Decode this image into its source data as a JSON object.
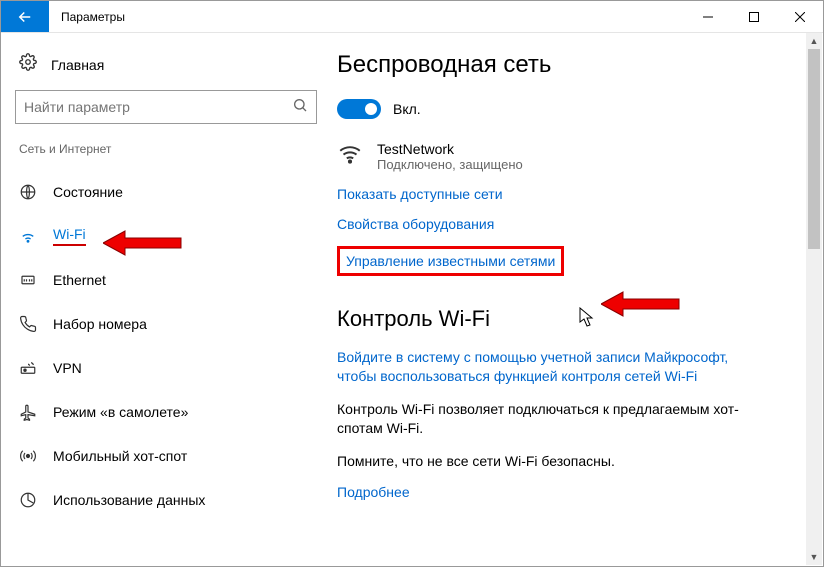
{
  "titlebar": {
    "title": "Параметры"
  },
  "sidebar": {
    "home": "Главная",
    "search_placeholder": "Найти параметр",
    "category": "Сеть и Интернет",
    "items": [
      {
        "label": "Состояние"
      },
      {
        "label": "Wi-Fi"
      },
      {
        "label": "Ethernet"
      },
      {
        "label": "Набор номера"
      },
      {
        "label": "VPN"
      },
      {
        "label": "Режим «в самолете»"
      },
      {
        "label": "Мобильный хот-спот"
      },
      {
        "label": "Использование данных"
      }
    ]
  },
  "main": {
    "heading": "Беспроводная сеть",
    "toggle_label": "Вкл.",
    "network": {
      "name": "TestNetwork",
      "status": "Подключено, защищено"
    },
    "link_show_networks": "Показать доступные сети",
    "link_hardware": "Свойства оборудования",
    "link_manage": "Управление известными сетями",
    "wifi_sense_heading": "Контроль Wi-Fi",
    "link_signin": "Войдите в систему с помощью учетной записи Майкрософт, чтобы воспользоваться функцией контроля сетей Wi-Fi",
    "text1": "Контроль Wi-Fi позволяет подключаться к предлагаемым хот-спотам Wi-Fi.",
    "text2": "Помните, что не все сети Wi-Fi безопасны.",
    "link_more": "Подробнее"
  }
}
